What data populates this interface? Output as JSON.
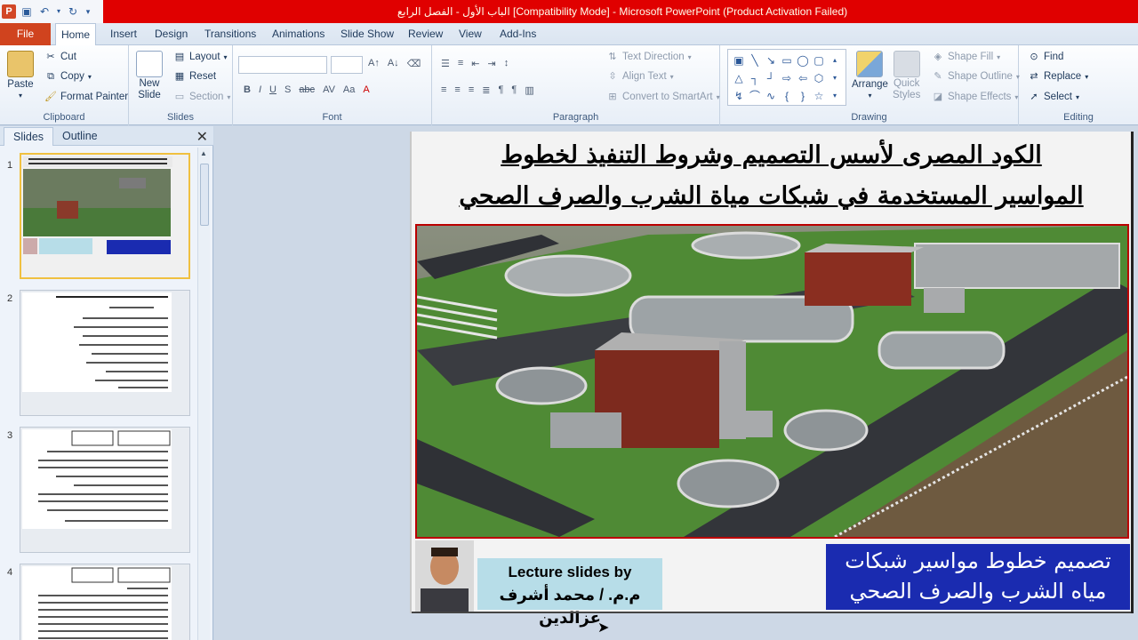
{
  "titlebar": {
    "app_letter": "P",
    "title": "الباب الأول - الفصل الرابع [Compatibility Mode] - Microsoft PowerPoint (Product Activation Failed)"
  },
  "tabs": {
    "file": "File",
    "items": [
      "Home",
      "Insert",
      "Design",
      "Transitions",
      "Animations",
      "Slide Show",
      "Review",
      "View",
      "Add-Ins"
    ],
    "active": "Home"
  },
  "ribbon": {
    "clipboard": {
      "label": "Clipboard",
      "paste": "Paste",
      "cut": "Cut",
      "copy": "Copy",
      "format_painter": "Format Painter"
    },
    "slides": {
      "label": "Slides",
      "new_slide_1": "New",
      "new_slide_2": "Slide",
      "layout": "Layout",
      "reset": "Reset",
      "section": "Section"
    },
    "font": {
      "label": "Font",
      "font_name": "",
      "font_size": ""
    },
    "paragraph": {
      "label": "Paragraph",
      "text_direction": "Text Direction",
      "align_text": "Align Text",
      "convert_smartart": "Convert to SmartArt"
    },
    "drawing": {
      "label": "Drawing",
      "arrange": "Arrange",
      "quick_styles_1": "Quick",
      "quick_styles_2": "Styles",
      "shape_fill": "Shape Fill",
      "shape_outline": "Shape Outline",
      "shape_effects": "Shape Effects"
    },
    "editing": {
      "label": "Editing",
      "find": "Find",
      "replace": "Replace",
      "select": "Select"
    }
  },
  "left_pane": {
    "tab_slides": "Slides",
    "tab_outline": "Outline",
    "thumbnails": [
      {
        "num": "1",
        "selected": true
      },
      {
        "num": "2",
        "selected": false
      },
      {
        "num": "3",
        "selected": false
      },
      {
        "num": "4",
        "selected": false
      }
    ]
  },
  "slide": {
    "title_line1": "الكود المصرى لأسس التصميم وشروط التنفيذ لخطوط",
    "title_line2": "المواسير المستخدمة في شبكات مياة الشرب والصرف الصحي",
    "blue_line1": "تصميم خطوط مواسير شبكات",
    "blue_line2": "مياه الشرب والصرف الصحي",
    "lecture_line1": "Lecture slides by",
    "lecture_line2": "م.م. / محمد أشرف عزالدين"
  },
  "colors": {
    "titlebar": "#e00000",
    "file_tab": "#d0431e",
    "blue_box": "#1a2bb0",
    "lecture_box": "#b7dde8",
    "photo_border": "#bb0000"
  }
}
